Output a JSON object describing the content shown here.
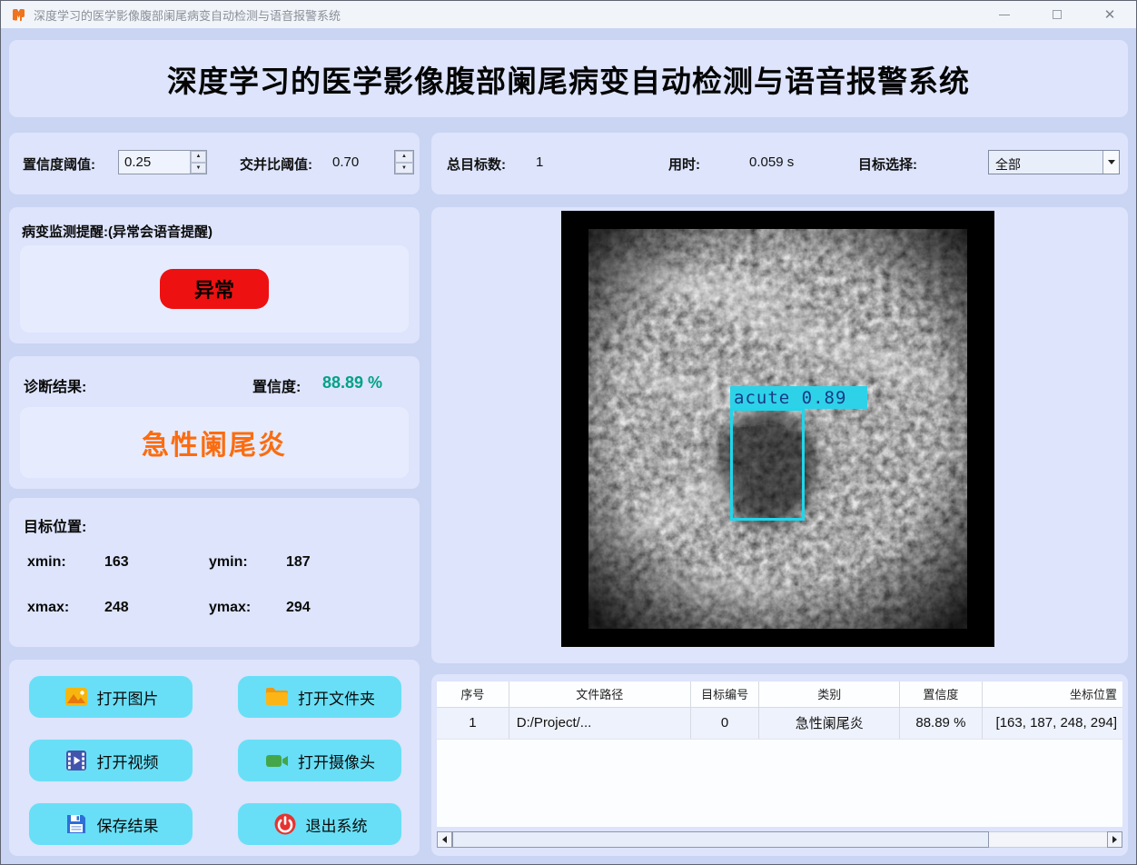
{
  "window": {
    "title": "深度学习的医学影像腹部阑尾病变自动检测与语音报警系统"
  },
  "header": {
    "title": "深度学习的医学影像腹部阑尾病变自动检测与语音报警系统"
  },
  "thresholds": {
    "conf_label": "置信度阈值:",
    "conf_value": "0.25",
    "iou_label": "交并比阈值:",
    "iou_value": "0.70"
  },
  "stats": {
    "total_label": "总目标数:",
    "total_value": "1",
    "time_label": "用时:",
    "time_value": "0.059 s",
    "select_label": "目标选择:",
    "select_value": "全部"
  },
  "alert": {
    "label": "病变监测提醒:(异常会语音提醒)",
    "status": "异常",
    "status_color": "#ee1111"
  },
  "diagnosis": {
    "label": "诊断结果:",
    "conf_label": "置信度:",
    "conf_value": "88.89 %",
    "conf_color": "#00a186",
    "result": "急性阑尾炎",
    "result_color": "#fb6c10"
  },
  "position": {
    "label": "目标位置:",
    "xmin_label": "xmin:",
    "xmin_value": "163",
    "ymin_label": "ymin:",
    "ymin_value": "187",
    "xmax_label": "xmax:",
    "xmax_value": "248",
    "ymax_label": "ymax:",
    "ymax_value": "294"
  },
  "buttons": [
    {
      "label": "打开图片",
      "icon": "image-icon"
    },
    {
      "label": "打开文件夹",
      "icon": "folder-icon"
    },
    {
      "label": "打开视频",
      "icon": "video-icon"
    },
    {
      "label": "打开摄像头",
      "icon": "camera-icon"
    },
    {
      "label": "保存结果",
      "icon": "save-icon"
    },
    {
      "label": "退出系统",
      "icon": "power-icon"
    }
  ],
  "viewer": {
    "detection_label": "acute 0.89",
    "box_color": "#1fd6ec"
  },
  "table": {
    "headers": [
      "序号",
      "文件路径",
      "目标编号",
      "类别",
      "置信度",
      "坐标位置"
    ],
    "rows": [
      [
        "1",
        "D:/Project/...",
        "0",
        "急性阑尾炎",
        "88.89 %",
        "[163, 187, 248, 294]"
      ]
    ]
  },
  "colors": {
    "background": "#c9d5f2",
    "panel": "#dde4fb",
    "inner_panel": "#e6ecfe",
    "tool_button": "#68dff7",
    "alert_red": "#ee1111",
    "result_orange": "#fb6c10",
    "confidence_teal": "#00a186",
    "detection_cyan": "#1fd6ec"
  }
}
